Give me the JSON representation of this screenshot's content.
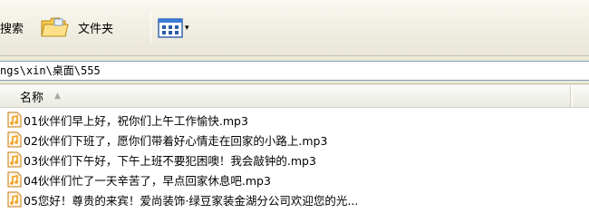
{
  "toolbar": {
    "search_label": "搜索",
    "folders_label": "文件夹",
    "views_icon": "views-icon",
    "views_caret": "▾"
  },
  "address": {
    "path": "ngs\\xin\\桌面\\555"
  },
  "list": {
    "columns": [
      {
        "label": "名称",
        "sort": "ascending"
      }
    ],
    "files": [
      {
        "name": "01伙伴们早上好，祝你们上午工作愉快.mp3",
        "icon": "mp3-file-icon"
      },
      {
        "name": "02伙伴们下班了，愿你们带着好心情走在回家的小路上.mp3",
        "icon": "mp3-file-icon"
      },
      {
        "name": "03伙伴们下午好，下午上班不要犯困噢！我会敲钟的.mp3",
        "icon": "mp3-file-icon"
      },
      {
        "name": "04伙伴们忙了一天辛苦了，早点回家休息吧.mp3",
        "icon": "mp3-file-icon"
      },
      {
        "name": "05您好！尊贵的来宾！爱尚装饰·绿豆家装金湖分公司欢迎您的光...",
        "icon": "mp3-file-icon"
      }
    ]
  },
  "colors": {
    "toolbar_bg": "#ece9d8",
    "address_border": "#7f9db9",
    "folder_yellow": "#f5c94c",
    "mp3_orange": "#f0a020"
  }
}
